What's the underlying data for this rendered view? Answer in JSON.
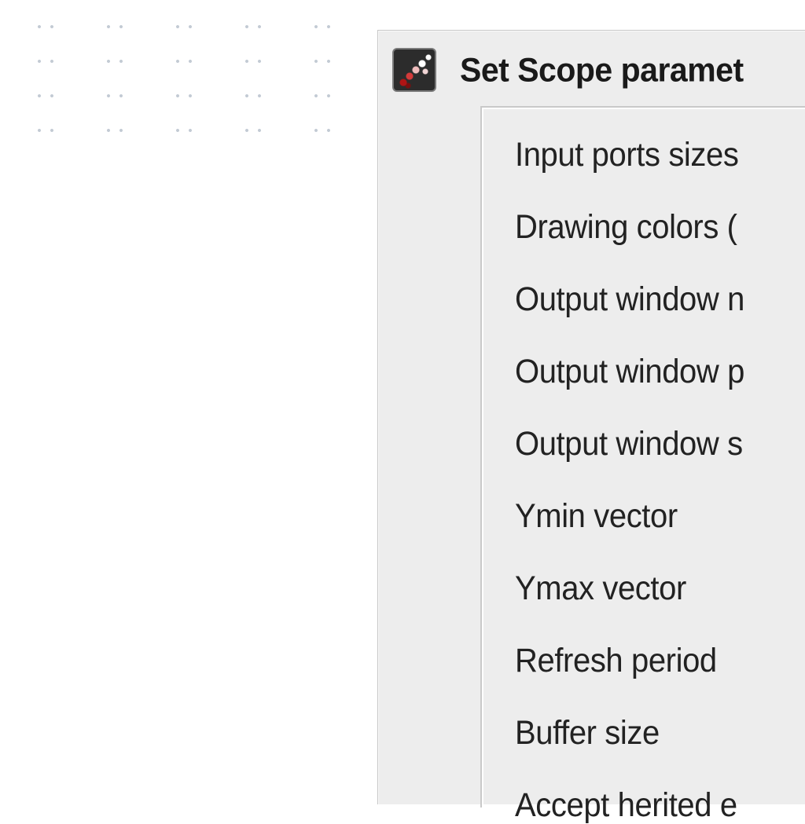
{
  "dialog": {
    "title": "Set Scope paramet",
    "icon": "scope-block-icon",
    "fields": [
      {
        "label": "Input ports sizes"
      },
      {
        "label": "Drawing colors ("
      },
      {
        "label": "Output window n"
      },
      {
        "label": "Output window p"
      },
      {
        "label": "Output window s"
      },
      {
        "label": "Ymin vector"
      },
      {
        "label": "Ymax vector"
      },
      {
        "label": "Refresh period"
      },
      {
        "label": "Buffer size"
      },
      {
        "label": "Accept herited e"
      }
    ]
  }
}
